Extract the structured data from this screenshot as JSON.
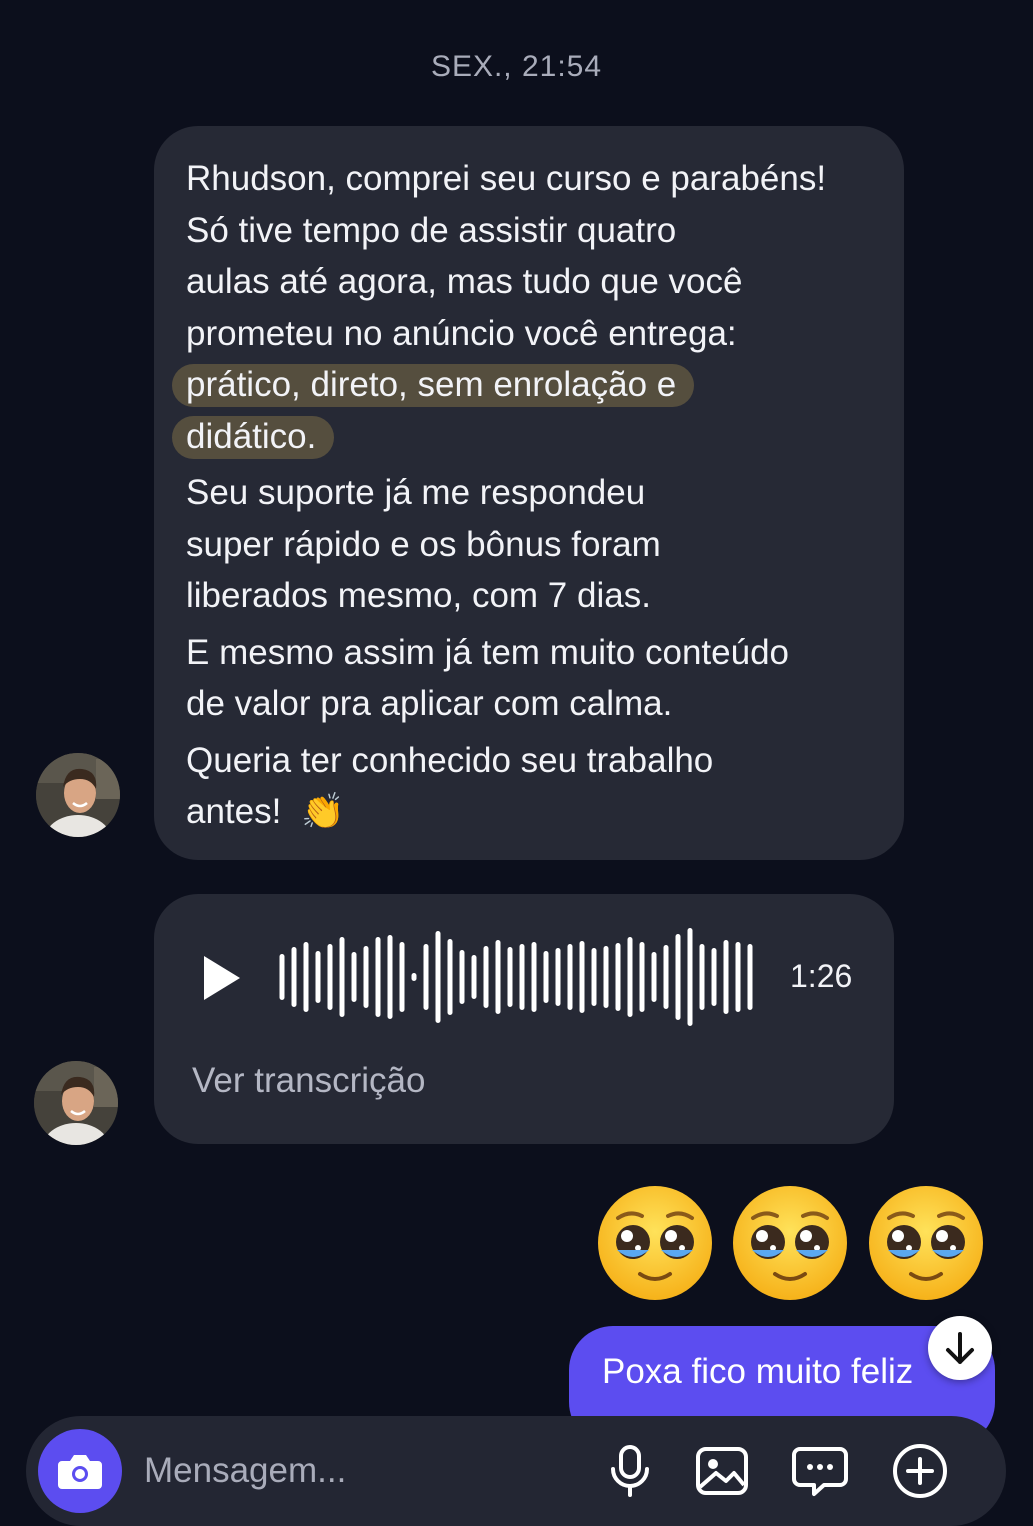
{
  "conversation": {
    "timestamp": "SEX., 21:54"
  },
  "messages": {
    "received_text": {
      "lines": [
        "Rhudson, comprei seu curso e parabéns!",
        "Só tive tempo de assistir quatro",
        "aulas até agora, mas tudo que você",
        "prometeu no anúncio você entrega:",
        "prático, direto, sem enrolação e",
        "didático.",
        "Seu suporte já me respondeu",
        "super rápido e os bônus foram",
        "liberados mesmo, com 7 dias.",
        "E mesmo assim já tem muito conteúdo",
        "de valor pra aplicar com calma.",
        "Queria ter conhecido seu trabalho",
        "antes!"
      ],
      "trailing_emoji": "👏"
    },
    "received_audio": {
      "duration": "1:26",
      "transcript_link": "Ver transcrição"
    },
    "sent_emojis": [
      "🥹",
      "🥹",
      "🥹"
    ],
    "sent_text": "Poxa fico muito feliz"
  },
  "composer": {
    "placeholder": "Mensagem..."
  },
  "colors": {
    "background": "#0c0f1c",
    "bubble_received": "#262935",
    "bubble_sent": "#5c4df0",
    "highlight": "#554e3e",
    "accent": "#5c4df0"
  }
}
